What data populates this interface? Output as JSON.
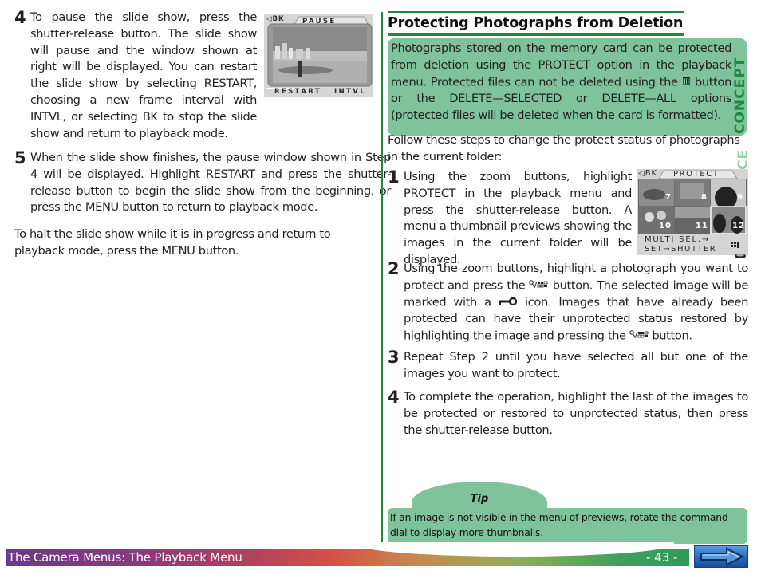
{
  "left": {
    "step4": {
      "number": "4",
      "text": "To pause the slide show, press the shutter-release button. The slide show will pause and the window shown at right will be displayed. You can restart the slide show by selecting RESTART, choosing a new frame interval with INTVL, or selecting BK to stop the slide show and return to playback mode."
    },
    "pause_screen": {
      "back_label": "◁BK",
      "title": "PAUSE",
      "options": [
        "RESTART",
        "INTVL"
      ]
    },
    "step5": {
      "number": "5",
      "text": "When the slide show finishes, the pause window shown in Step 4 will be displayed. Highlight RESTART and press the shutter-release button to begin the slide show from the beginning, or press the MENU button to return to playback mode."
    },
    "halt_text": "To halt the slide show while it is in progress and return to playback mode, press the MENU button."
  },
  "right": {
    "section_title": "Protecting Photographs from Deletion",
    "concept": {
      "tag": "CONCEPT",
      "text_before_icon": "Photographs stored on the memory card can be protected from deletion using the PROTECT option in the playback menu. Protected files can not be deleted using the ",
      "text_after_icon": " button or the DELETE—SELECTED or DELETE—ALL options (protected files will be deleted when the card is formatted)."
    },
    "practice_tag": "PRACTICE",
    "intro": "Follow these steps to change the protect status of photographs in the current folder:",
    "steps": [
      {
        "number": "1",
        "text": "Using the zoom buttons, highlight PROTECT in the playback menu and press the shutter-release button. A menu a thumbnail previews showing the images in the current folder will be displayed."
      },
      {
        "number": "2",
        "part1": "Using the zoom buttons, highlight a photograph you want to protect and press the ",
        "part2": " button. The selected image will be marked with a ",
        "part3": " icon. Images that have already been protected can have their unprotected status restored by highlighting the image and pressing the ",
        "part4": " button."
      },
      {
        "number": "3",
        "text": "Repeat Step 2 until you have selected all but one of the images you want to protect."
      },
      {
        "number": "4",
        "text": "To complete the operation, highlight the last of the images to be protected or restored to unprotected status, then press the shutter-release button."
      }
    ],
    "protect_screen": {
      "back_label": "◁BK",
      "title": "PROTECT",
      "thumbnails": [
        "7",
        "8",
        "9",
        "10",
        "11",
        "12"
      ],
      "selected_thumbnail": "12",
      "line1": "MULTI SEL.→",
      "line2": "SET→SHUTTER"
    },
    "tip": {
      "label": "Tip",
      "text": "If an image is not visible in the menu of previews, rotate the command dial to display more thumbnails."
    }
  },
  "footer": {
    "title": "The Camera Menus: The Playback Menu",
    "page_number": "- 43 -",
    "next_label": "next-page"
  },
  "colors": {
    "accent_green": "#1e8a3d",
    "box_green": "#7fc39a",
    "practice_green": "#8dd0a4"
  }
}
